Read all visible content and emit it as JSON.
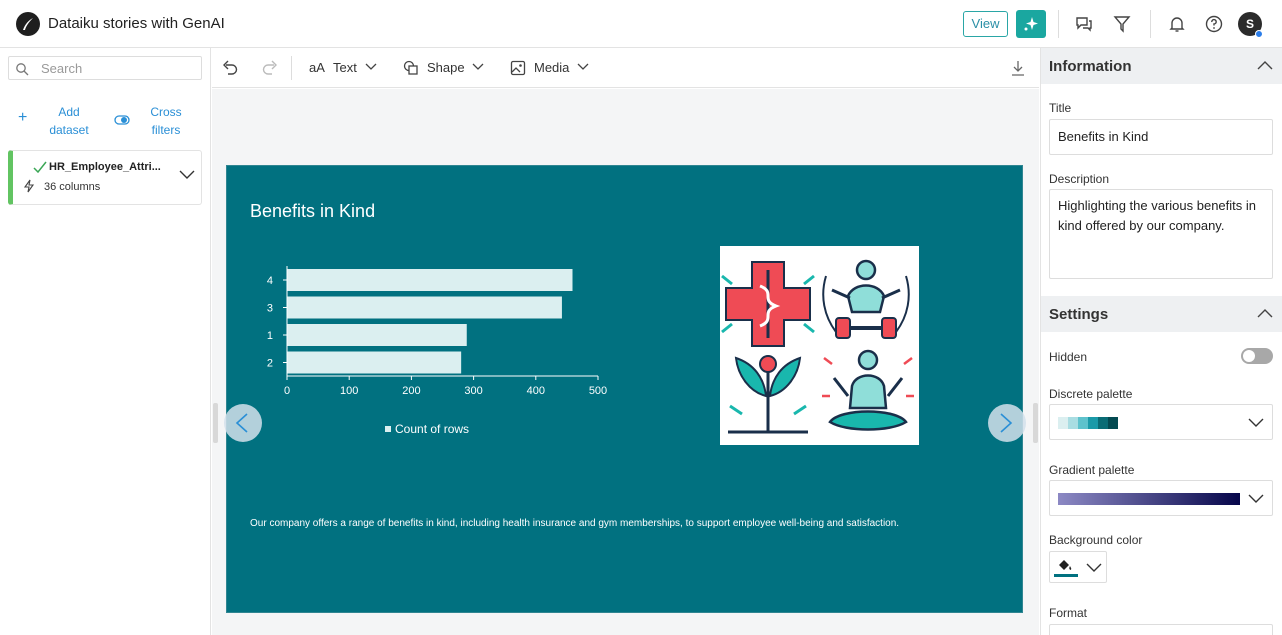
{
  "app": {
    "title": "Dataiku stories with GenAI",
    "view_label": "View",
    "avatar_initial": "S"
  },
  "sidebar": {
    "search_placeholder": "Search",
    "add_dataset_label": "Add dataset",
    "cross_filters_label": "Cross filters",
    "dataset": {
      "name": "HR_Employee_Attri...",
      "columns": "36 columns"
    }
  },
  "toolbar": {
    "text_label": "Text",
    "shape_label": "Shape",
    "media_label": "Media",
    "text_icon_glyph": "aA"
  },
  "slide": {
    "title": "Benefits in Kind",
    "description": "Our company offers a range of benefits in kind, including health insurance and gym memberships, to support employee well-being and satisfaction.",
    "background": "#017180"
  },
  "chart_data": {
    "type": "bar",
    "orientation": "horizontal",
    "categories": [
      "4",
      "3",
      "1",
      "2"
    ],
    "series": [
      {
        "name": "Count of rows",
        "values": [
          459,
          442,
          289,
          280
        ]
      }
    ],
    "xlim": [
      0,
      500
    ],
    "xticks": [
      "0",
      "100",
      "200",
      "300",
      "400",
      "500"
    ],
    "legend": "bottom",
    "bar_color": "#dbeff0"
  },
  "panel": {
    "information_header": "Information",
    "title_label": "Title",
    "title_value": "Benefits in Kind",
    "description_label": "Description",
    "description_value": "Highlighting the various benefits in kind offered by our company.",
    "settings_header": "Settings",
    "hidden_label": "Hidden",
    "discrete_palette_label": "Discrete palette",
    "discrete_palette_colors": [
      "#dbeff0",
      "#a9dde2",
      "#5ec2cc",
      "#1b9aa8",
      "#0a6c75",
      "#034a51"
    ],
    "gradient_palette_label": "Gradient palette",
    "gradient_palette_colors": [
      "#8c89c4",
      "#06064a"
    ],
    "background_color_label": "Background color",
    "background_color_value": "#017180",
    "format_label": "Format"
  }
}
